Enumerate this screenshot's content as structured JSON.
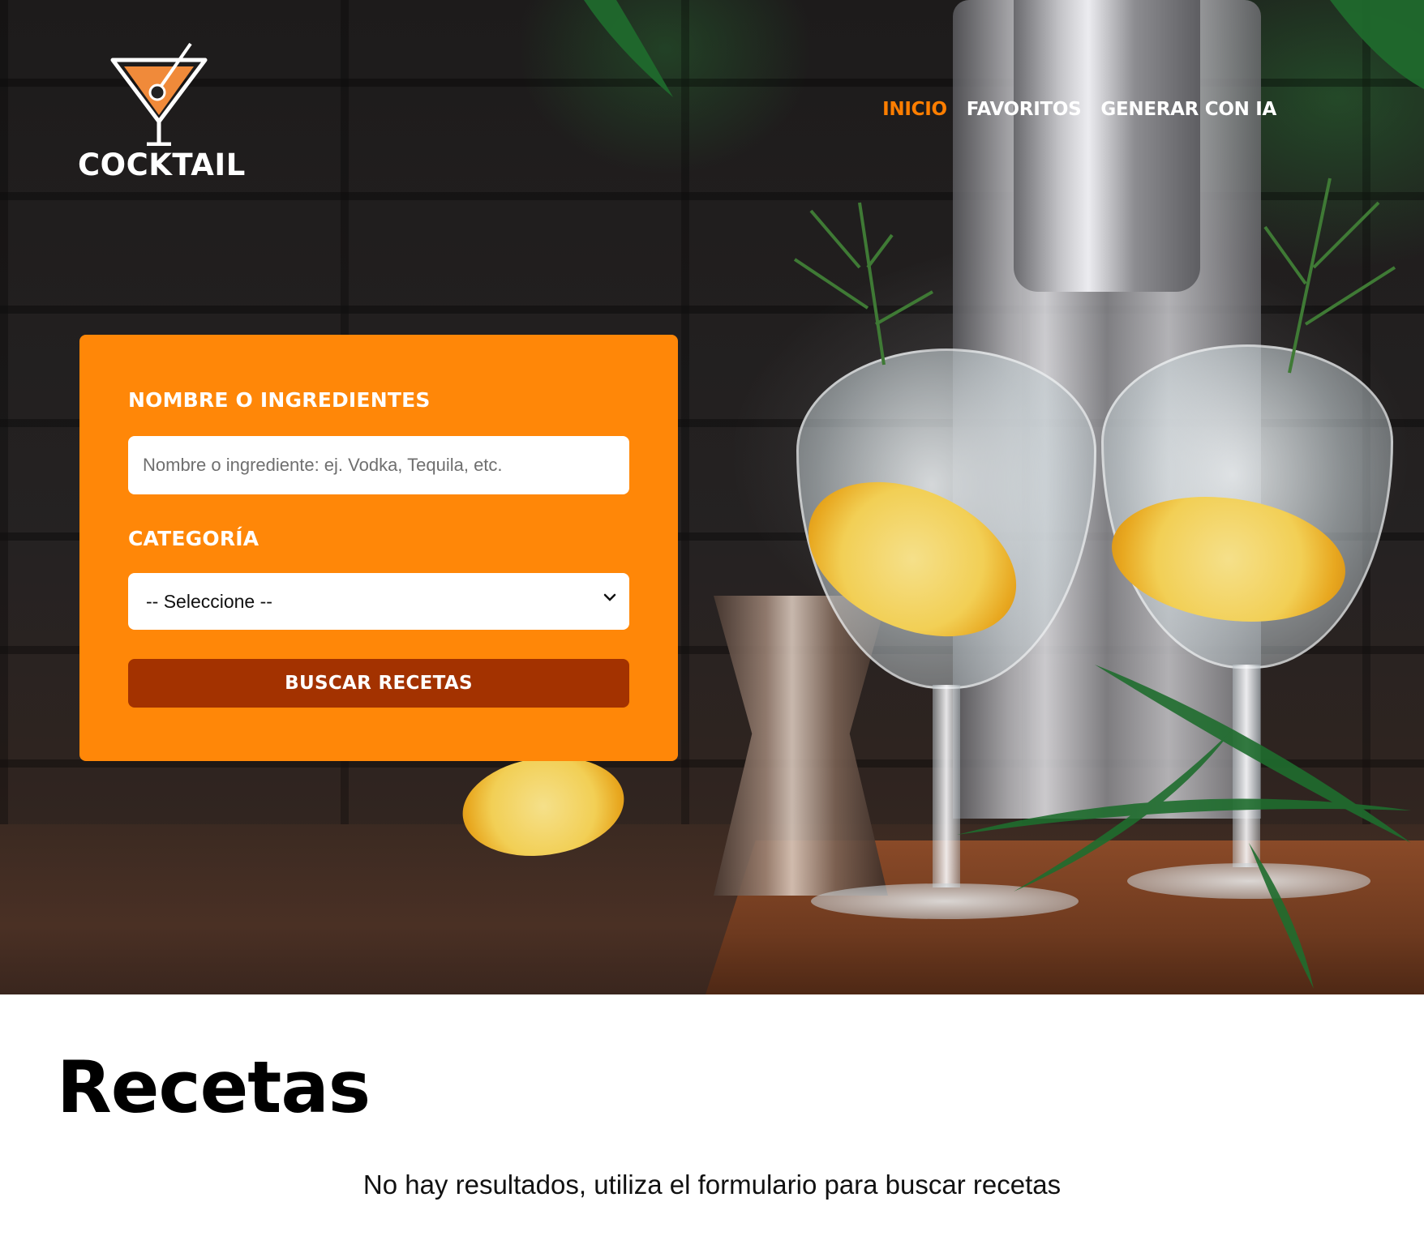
{
  "brand": {
    "name": "COCKTAIL",
    "logo_icon": "martini-glass-icon",
    "accent_color": "#ff8708"
  },
  "nav": {
    "items": [
      {
        "label": "INICIO",
        "active": true
      },
      {
        "label": "FAVORITOS",
        "active": false
      },
      {
        "label": "GENERAR CON IA",
        "active": false
      }
    ]
  },
  "search_form": {
    "name_label": "NOMBRE O INGREDIENTES",
    "name_placeholder": "Nombre o ingrediente: ej. Vodka, Tequila, etc.",
    "name_value": "",
    "category_label": "CATEGORÍA",
    "category_selected": "-- Seleccione --",
    "submit_label": "BUSCAR RECETAS",
    "submit_color": "#a33200"
  },
  "results": {
    "title": "Recetas",
    "empty_message": "No hay resultados, utiliza el formulario para buscar recetas"
  }
}
